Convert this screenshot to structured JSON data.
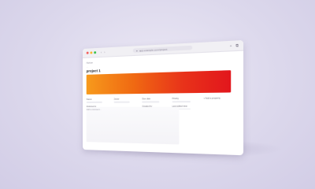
{
  "colors": {
    "close": "#f35b58",
    "minimize": "#f8b62d",
    "maximize": "#34c049",
    "banner_start": "#f79a1c",
    "banner_end": "#e2161c"
  },
  "titlebar": {
    "back_icon": "chevron-left-icon",
    "forward_icon": "chevron-right-icon",
    "url": "app.example.com/project",
    "lock_icon": "lock-icon",
    "actions": [
      {
        "name": "add-icon",
        "glyph": "+"
      },
      {
        "name": "copy-icon",
        "glyph": "⧉"
      }
    ]
  },
  "page": {
    "workspace": "Notion",
    "breadcrumb": "...",
    "title": "project 1",
    "properties": [
      {
        "label": "Status"
      },
      {
        "label": "Owner"
      },
      {
        "label": "Due date"
      },
      {
        "label": "Priority"
      },
      {
        "label": "+ Add a property"
      }
    ],
    "properties_row2": [
      {
        "label": "Assigned to"
      },
      {
        "label": ""
      },
      {
        "label": "Created by"
      },
      {
        "label": "Last edited time"
      },
      {
        "label": ""
      }
    ],
    "comment_label": "Add a comment..."
  }
}
